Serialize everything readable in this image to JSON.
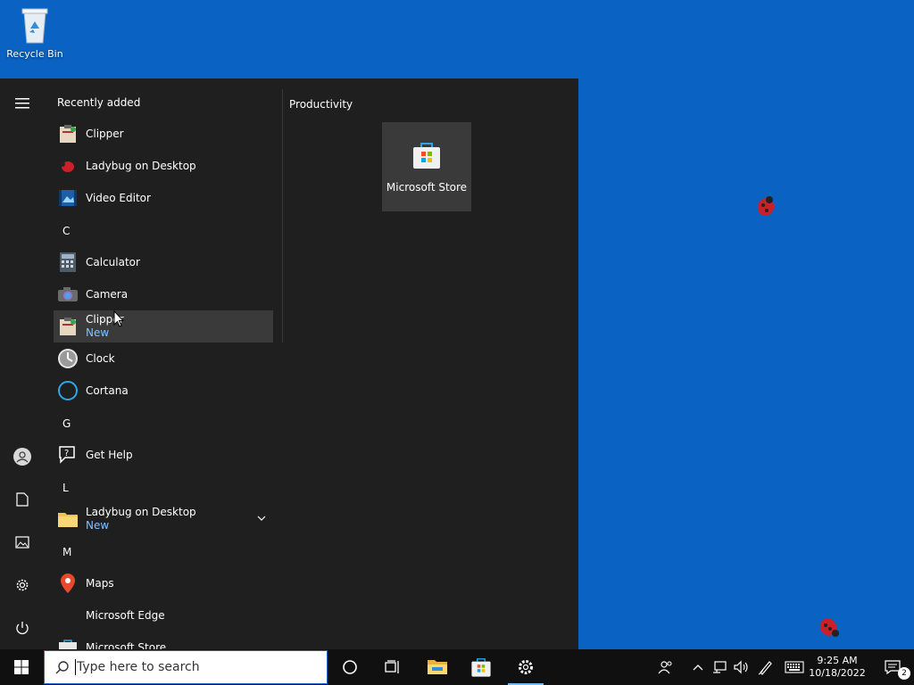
{
  "desktop": {
    "recycle_bin_label": "Recycle Bin"
  },
  "start_menu": {
    "recently_added_title": "Recently added",
    "recent": [
      {
        "label": "Clipper",
        "icon": "clipboard-icon"
      },
      {
        "label": "Ladybug on Desktop",
        "icon": "ladybug-icon"
      },
      {
        "label": "Video Editor",
        "icon": "video-editor-icon"
      }
    ],
    "letters": {
      "c": "C",
      "g": "G",
      "l": "L",
      "m": "M"
    },
    "apps": {
      "calculator": "Calculator",
      "camera": "Camera",
      "clipper": "Clipper",
      "clipper_badge": "New",
      "clock": "Clock",
      "cortana": "Cortana",
      "get_help": "Get Help",
      "ladybug_folder": "Ladybug on Desktop",
      "ladybug_badge": "New",
      "maps": "Maps",
      "edge": "Microsoft Edge",
      "store": "Microsoft Store"
    },
    "tiles_group_title": "Productivity",
    "tile_store_label": "Microsoft Store"
  },
  "taskbar": {
    "search_placeholder": "Type here to search",
    "time": "9:25 AM",
    "date": "10/18/2022",
    "notification_count": "2"
  },
  "colors": {
    "desktop_bg": "#0a62c2",
    "menu_bg": "#1f1f1f",
    "accent_new": "#7ec3ff"
  }
}
